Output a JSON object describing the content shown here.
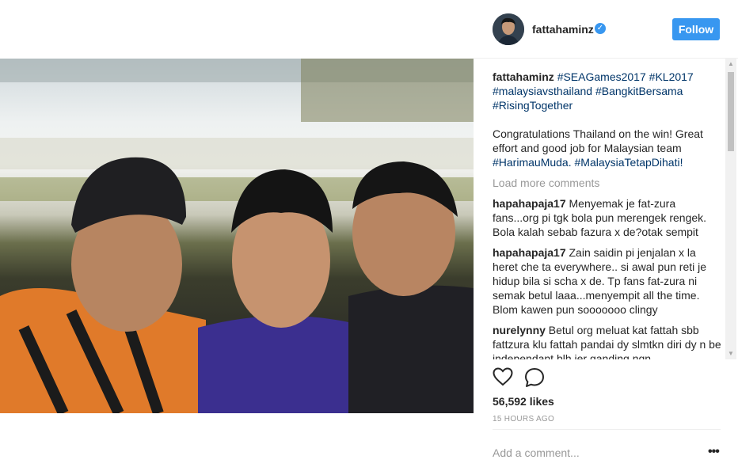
{
  "post": {
    "username": "fattahaminz",
    "follow_label": "Follow",
    "verified_glyph": "✓",
    "likes": "56,592 likes",
    "time": "15 HOURS AGO",
    "add_comment_placeholder": "Add a comment...",
    "more_label": "•••"
  },
  "caption": {
    "username": "fattahaminz",
    "tags": [
      "#SEAGames2017",
      "#KL2017",
      "#malaysiavsthailand",
      "#BangkitBersama",
      "#RisingTogether"
    ],
    "body_text": "Congratulations Thailand on the win! Great effort and good job for Malaysian team ",
    "body_tags": [
      "#HarimauMuda.",
      "#MalaysiaTetapDihati!"
    ]
  },
  "load_more_label": "Load more comments",
  "comments": [
    {
      "user": "hapahapaja17",
      "text": "Menyemak je fat-zura fans...org pi tgk bola pun merengek rengek. Bola kalah sebab fazura x de?otak sempit"
    },
    {
      "user": "hapahapaja17",
      "text": "Zain saidin pi jenjalan x la heret che ta everywhere.. si awal pun reti je hidup bila si scha x de. Tp fans fat-zura ni semak betul laaa...menyempit all the time. Blom kawen pun sooooooo clingy"
    },
    {
      "user": "nurelynny",
      "text": "Betul org meluat kat fattah sbb fattzura klu fattah pandai dy slmtkn diri dy n be independant blh jer gandinq nqn"
    }
  ],
  "icons": {
    "heart": "heart-icon",
    "comment": "comment-icon",
    "verified": "verified-badge-icon",
    "more": "more-options-icon"
  },
  "colors": {
    "accent": "#3897f0",
    "hashtag": "#003569",
    "muted": "#999999"
  }
}
